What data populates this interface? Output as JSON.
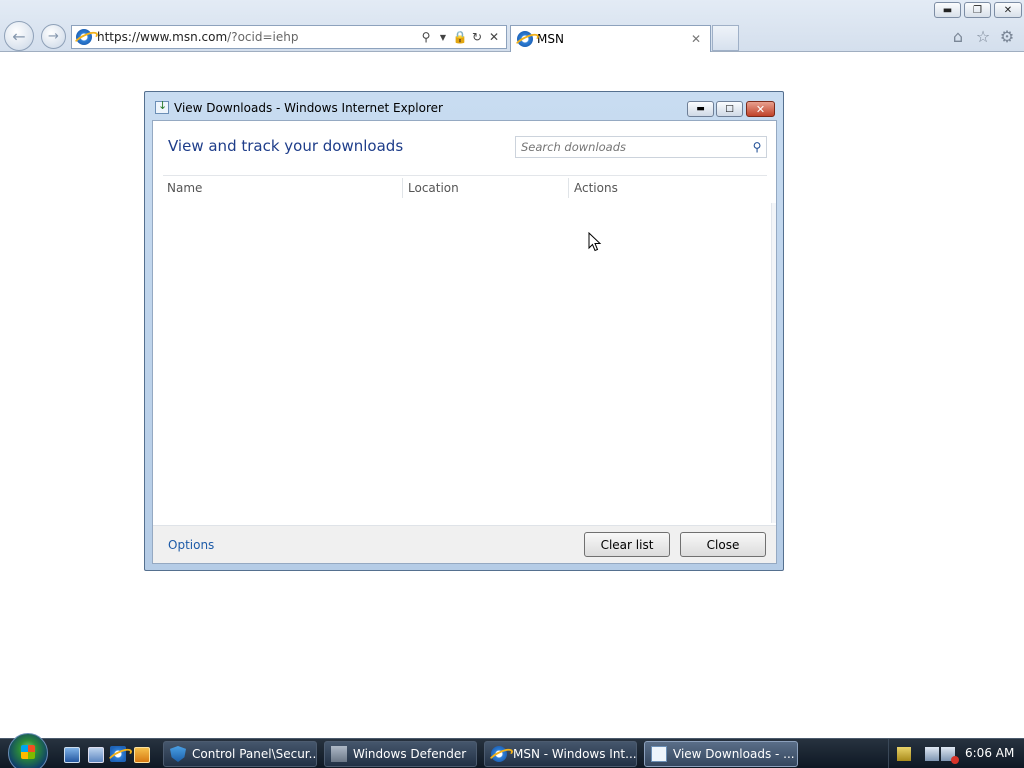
{
  "browser": {
    "address": {
      "protocol": "https://",
      "host": "www.msn.com",
      "path": "/?ocid=iehp"
    },
    "tab": {
      "label": "MSN"
    },
    "icons": [
      "back-arrow-icon",
      "forward-arrow-icon",
      "search-icon",
      "dropdown-icon",
      "lock-icon",
      "refresh-icon",
      "stop-icon",
      "home-icon",
      "favorites-star-icon",
      "gear-icon"
    ]
  },
  "dialog": {
    "title": "View Downloads - Windows Internet Explorer",
    "heading": "View and track your downloads",
    "search_placeholder": "Search downloads",
    "columns": {
      "name": "Name",
      "location": "Location",
      "actions": "Actions"
    },
    "options_label": "Options",
    "clear_label": "Clear list",
    "close_label": "Close",
    "accent": "#1e3d8a"
  },
  "taskbar": {
    "items": [
      {
        "label": "Control Panel\\Secur...",
        "icon": "shield-icon"
      },
      {
        "label": "Windows Defender",
        "icon": "defender-icon"
      },
      {
        "label": "MSN - Windows Int...",
        "icon": "ie-icon"
      },
      {
        "label": "View Downloads - ...",
        "icon": "downloads-icon"
      }
    ],
    "clock": "6:06 AM"
  }
}
